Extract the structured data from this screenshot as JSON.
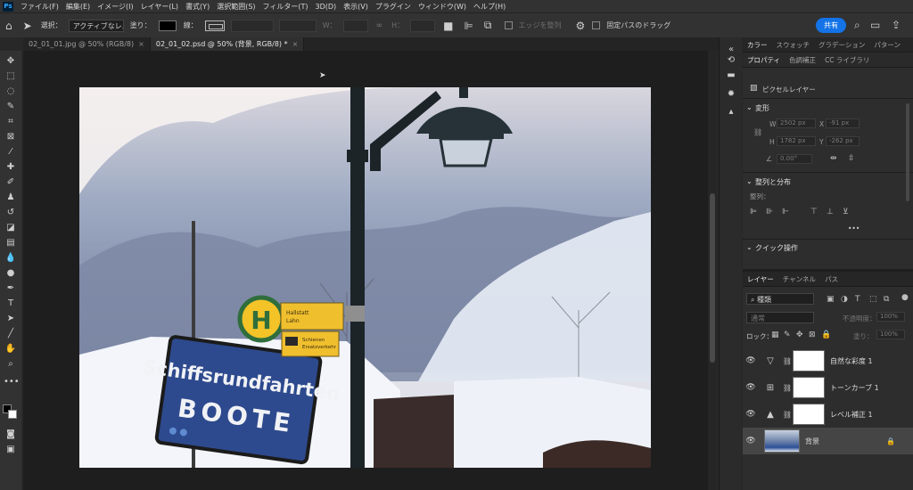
{
  "app": {
    "logo_text": "Ps"
  },
  "menu": [
    "ファイル(F)",
    "編集(E)",
    "イメージ(I)",
    "レイヤー(L)",
    "書式(Y)",
    "選択範囲(S)",
    "フィルター(T)",
    "3D(D)",
    "表示(V)",
    "プラグイン",
    "ウィンドウ(W)",
    "ヘルプ(H)"
  ],
  "options": {
    "select_label": "選択：",
    "select_value": "アクティブなレ...",
    "fill_label": "塗り：",
    "stroke_label": "線：",
    "w_label": "W：",
    "h_label": "H：",
    "edge_align_label": "エッジを整列",
    "fixed_path_label": "固定パスのドラッグ",
    "share_label": "共有"
  },
  "tabs": [
    {
      "label": "02_01_01.jpg @ 50% (RGB/8)",
      "active": false
    },
    {
      "label": "02_01_02.psd @ 50% (背景, RGB/8) *",
      "active": true
    }
  ],
  "panel_top": {
    "tabs": [
      "カラー",
      "スウォッチ",
      "グラデーション",
      "パターン"
    ],
    "subtabs": [
      "プロパティ",
      "色調補正",
      "CC ライブラリ"
    ],
    "pixel_layer_label": "ピクセルレイヤー",
    "transform": {
      "title": "変形",
      "w_label": "W",
      "w_value": "2502 px",
      "x_label": "X",
      "x_value": "-91 px",
      "h_label": "H",
      "h_value": "1782 px",
      "y_label": "Y",
      "y_value": "-262 px",
      "angle_value": "0.00°"
    },
    "align": {
      "title": "整列と分布",
      "label": "整列：",
      "more": "•••"
    },
    "quick_actions": {
      "title": "クイック操作"
    }
  },
  "layers_panel": {
    "tabs": [
      "レイヤー",
      "チャンネル",
      "パス"
    ],
    "filter_kind": "種類",
    "blend_mode": "通常",
    "opacity_label": "不透明度：",
    "opacity_value": "100%",
    "lock_label": "ロック：",
    "fill_label": "塗り：",
    "fill_value": "100%",
    "layers": [
      {
        "name": "自然な彩度 1",
        "type": "adjustment",
        "icon": "vibrance-icon"
      },
      {
        "name": "トーンカーブ 1",
        "type": "adjustment",
        "icon": "curves-icon"
      },
      {
        "name": "レベル補正 1",
        "type": "adjustment",
        "icon": "levels-icon"
      },
      {
        "name": "背景",
        "type": "background",
        "selected": true
      }
    ]
  },
  "image": {
    "sign_blue_line1": "Schiffsrundfahrten",
    "sign_blue_line2": "BOOTE",
    "bus_sign_letter": "H",
    "bus_sign_line1": "Hallstatt",
    "bus_sign_line2": "Lahn",
    "bus_sign_sub1": "Schienen",
    "bus_sign_sub2": "Ersatzverkehr"
  }
}
